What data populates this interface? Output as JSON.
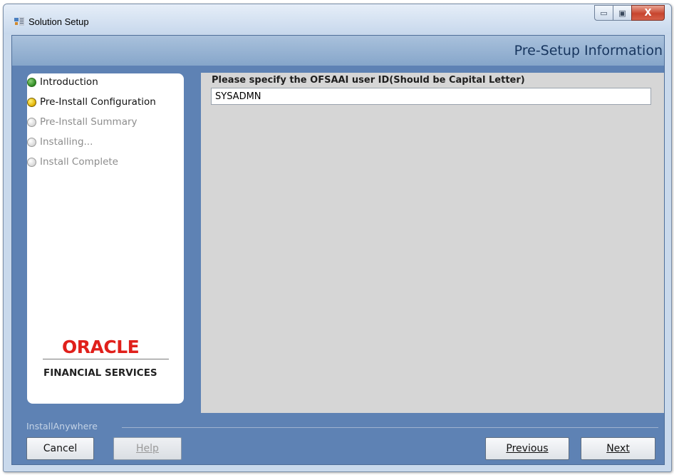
{
  "window": {
    "title": "Solution Setup"
  },
  "title_controls": {
    "minimize": "▭",
    "maximize": "▣",
    "close": "X"
  },
  "header": {
    "title": "Pre-Setup Information"
  },
  "steps": [
    {
      "label": "Introduction",
      "state": "done"
    },
    {
      "label": "Pre-Install Configuration",
      "state": "current"
    },
    {
      "label": "Pre-Install Summary",
      "state": "pending"
    },
    {
      "label": "Installing...",
      "state": "pending"
    },
    {
      "label": "Install Complete",
      "state": "pending"
    }
  ],
  "logo": {
    "brand": "ORACLE",
    "sub": "FINANCIAL SERVICES"
  },
  "form": {
    "label": "Please specify the OFSAAI user ID(Should be Capital Letter)",
    "value": "SYSADMN"
  },
  "footer": {
    "vendor": "InstallAnywhere",
    "cancel": "Cancel",
    "help": "Help",
    "previous": "Previous",
    "next": "Next"
  },
  "colors": {
    "accent": "#5e82b4",
    "header_text": "#17355e",
    "oracle_red": "#e0201b"
  }
}
